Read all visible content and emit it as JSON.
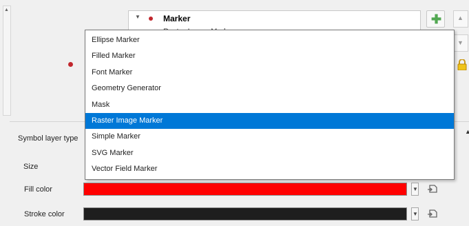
{
  "symbol_tree": {
    "root_label": "Marker",
    "sublayer_label": "Raster Image Marker"
  },
  "properties": {
    "symbol_layer_type_label": "Symbol layer type",
    "size_label": "Size",
    "fill_color_label": "Fill color",
    "stroke_color_label": "Stroke color",
    "fill_color": "#ff0000",
    "stroke_color": "#1e1e1e"
  },
  "popup": {
    "items": [
      {
        "label": "Ellipse Marker",
        "selected": false
      },
      {
        "label": "Filled Marker",
        "selected": false
      },
      {
        "label": "Font Marker",
        "selected": false
      },
      {
        "label": "Geometry Generator",
        "selected": false
      },
      {
        "label": "Mask",
        "selected": false
      },
      {
        "label": "Raster Image Marker",
        "selected": true
      },
      {
        "label": "Simple Marker",
        "selected": false
      },
      {
        "label": "SVG Marker",
        "selected": false
      },
      {
        "label": "Vector Field Marker",
        "selected": false
      }
    ]
  },
  "icons": {
    "add": "plus-icon",
    "lock": "lock-icon",
    "data_defined": "data-defined-override-icon",
    "expand": "chevron-down-icon"
  },
  "colors": {
    "accent": "#0078d7",
    "marker": "#c1272d",
    "add_icon": "#52a852"
  }
}
